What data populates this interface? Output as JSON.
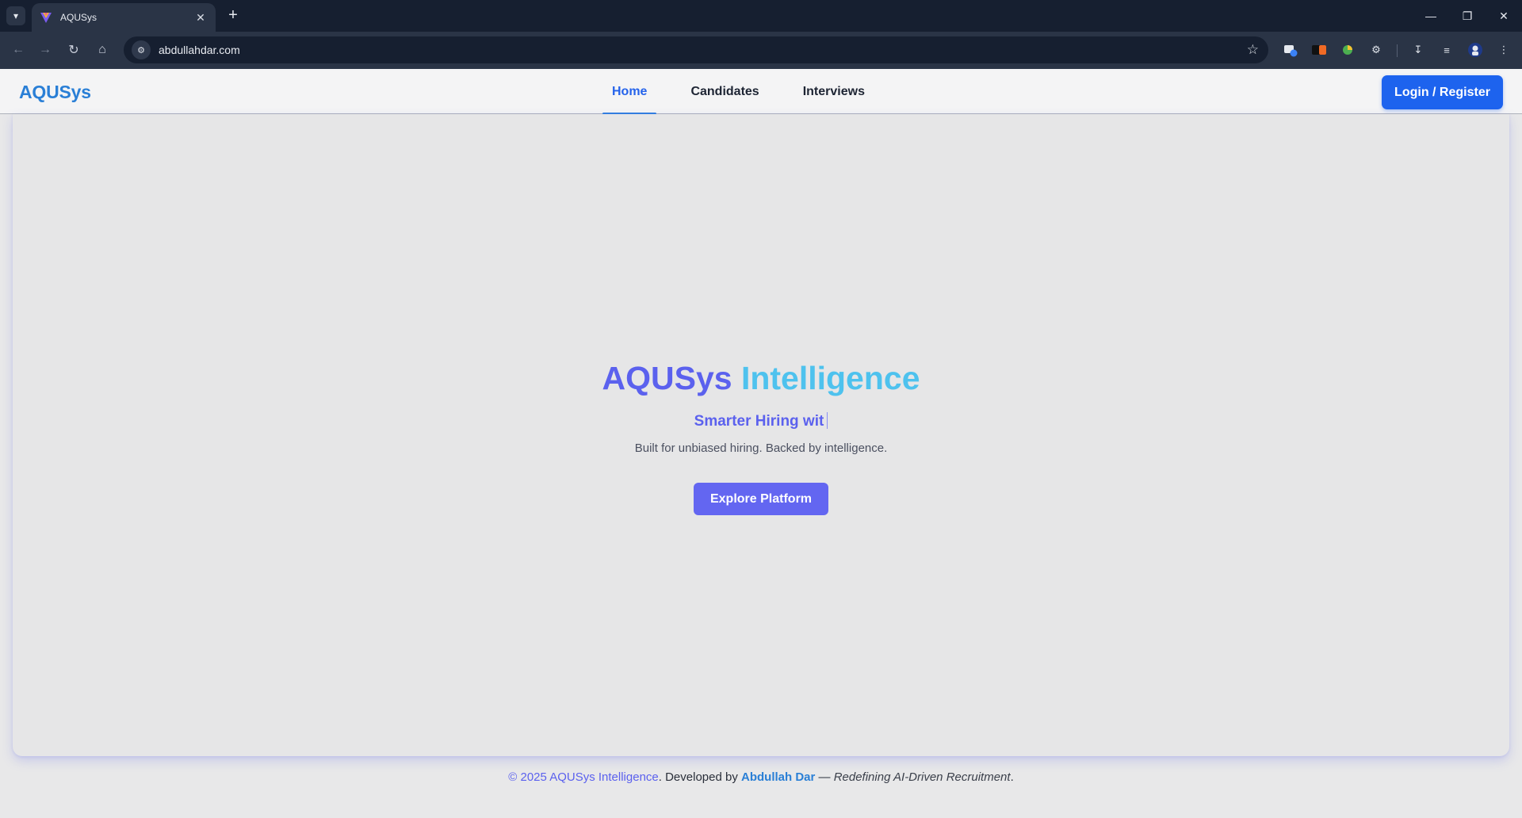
{
  "browser": {
    "tab_title": "AQUSys",
    "url": "abdullahdar.com"
  },
  "site": {
    "logo": "AQUSys",
    "nav": [
      {
        "label": "Home",
        "active": true
      },
      {
        "label": "Candidates",
        "active": false
      },
      {
        "label": "Interviews",
        "active": false
      }
    ],
    "login_label": "Login / Register"
  },
  "hero": {
    "title_part1": "AQUSys",
    "title_part2": "Intelligence",
    "subtitle": "Smarter Hiring wit",
    "description": "Built for unbiased hiring. Backed by intelligence.",
    "cta_label": "Explore Platform"
  },
  "footer": {
    "copyright": "© 2025 AQUSys Intelligence",
    "developed_by": ". Developed by ",
    "author": "Abdullah Dar",
    "separator": " — ",
    "tagline": "Redefining AI-Driven Recruitment",
    "end": "."
  },
  "colors": {
    "brand_blue": "#2a7fd6",
    "indigo": "#6366f1",
    "cyan": "#4ec2ee",
    "login_blue": "#1d63ee"
  },
  "icons": [
    "tab-search-icon",
    "favicon-icon",
    "close-icon",
    "plus-icon",
    "minimize-icon",
    "restore-icon",
    "back-icon",
    "forward-icon",
    "reload-icon",
    "home-icon",
    "site-info-icon",
    "bookmark-star-icon",
    "extension-icon",
    "download-icon",
    "reading-list-icon",
    "profile-avatar-icon",
    "menu-dots-icon"
  ]
}
